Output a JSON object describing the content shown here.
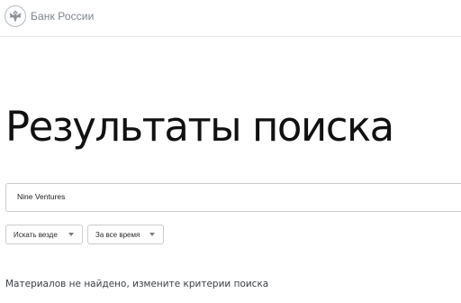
{
  "header": {
    "logo_text": "Банк России",
    "logo_icon": "eagle-emblem-icon"
  },
  "page": {
    "title": "Результаты поиска"
  },
  "search": {
    "value": "Nine Ventures"
  },
  "filters": {
    "where_label": "Искать везде",
    "time_label": "За все время",
    "caret_icon": "chevron-down-icon"
  },
  "results": {
    "empty_message": "Материалов не найдено, измените критерии поиска"
  }
}
